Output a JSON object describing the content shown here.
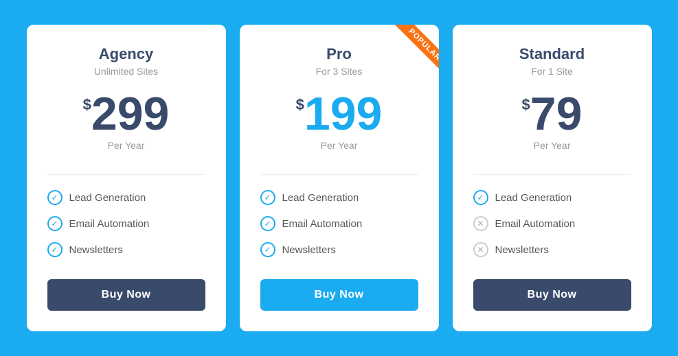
{
  "cards": [
    {
      "id": "agency",
      "name": "Agency",
      "subtitle": "Unlimited Sites",
      "price_dollar": "$",
      "price": "299",
      "price_period": "Per Year",
      "price_blue": false,
      "popular": false,
      "features": [
        {
          "label": "Lead Generation",
          "included": true
        },
        {
          "label": "Email Automation",
          "included": true
        },
        {
          "label": "Newsletters",
          "included": true
        }
      ],
      "btn_label": "Buy Now",
      "btn_style": "dark"
    },
    {
      "id": "pro",
      "name": "Pro",
      "subtitle": "For 3 Sites",
      "price_dollar": "$",
      "price": "199",
      "price_period": "Per Year",
      "price_blue": true,
      "popular": true,
      "popular_label": "POPULAR",
      "features": [
        {
          "label": "Lead Generation",
          "included": true
        },
        {
          "label": "Email Automation",
          "included": true
        },
        {
          "label": "Newsletters",
          "included": true
        }
      ],
      "btn_label": "Buy Now",
      "btn_style": "blue"
    },
    {
      "id": "standard",
      "name": "Standard",
      "subtitle": "For 1 Site",
      "price_dollar": "$",
      "price": "79",
      "price_period": "Per Year",
      "price_blue": false,
      "popular": false,
      "features": [
        {
          "label": "Lead Generation",
          "included": true
        },
        {
          "label": "Email Automation",
          "included": false
        },
        {
          "label": "Newsletters",
          "included": false
        }
      ],
      "btn_label": "Buy Now",
      "btn_style": "dark"
    }
  ]
}
